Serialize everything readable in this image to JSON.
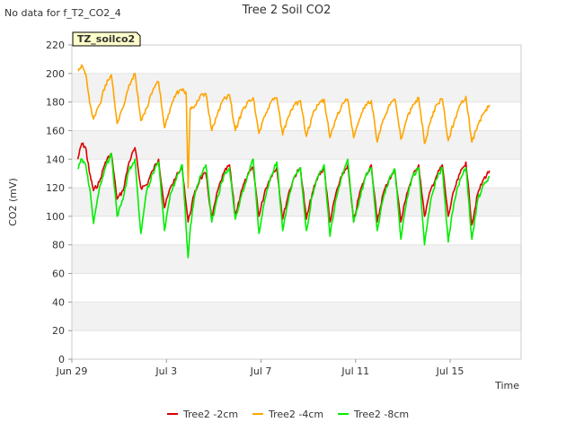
{
  "top_note": "No data for f_T2_CO2_4",
  "chart_data": {
    "type": "line",
    "title": "Tree 2 Soil CO2",
    "xlabel": "Time",
    "ylabel": "CO2 (mV)",
    "badge": "TZ_soilco2",
    "ylim": [
      0,
      220
    ],
    "yticks": [
      0,
      20,
      40,
      60,
      80,
      100,
      120,
      140,
      160,
      180,
      200,
      220
    ],
    "xlim": [
      "2023-06-29",
      "2023-07-18"
    ],
    "xticks": [
      {
        "date": "2023-06-29",
        "label": "Jun 29"
      },
      {
        "date": "2023-07-03",
        "label": "Jul 3"
      },
      {
        "date": "2023-07-07",
        "label": "Jul 7"
      },
      {
        "date": "2023-07-11",
        "label": "Jul 11"
      },
      {
        "date": "2023-07-15",
        "label": "Jul 15"
      }
    ],
    "grid": true,
    "legend_position": "bottom",
    "series": [
      {
        "name": "Tree2 -2cm",
        "color": "#dd0000",
        "points": [
          [
            "2023-06-29T06:00",
            140
          ],
          [
            "2023-06-29T10:00",
            151
          ],
          [
            "2023-06-29T14:00",
            148
          ],
          [
            "2023-06-29T18:00",
            130
          ],
          [
            "2023-06-29T22:00",
            118
          ],
          [
            "2023-06-30T04:00",
            124
          ],
          [
            "2023-06-30T10:00",
            138
          ],
          [
            "2023-06-30T16:00",
            144
          ],
          [
            "2023-06-30T22:00",
            112
          ],
          [
            "2023-07-01T04:00",
            118
          ],
          [
            "2023-07-01T10:00",
            138
          ],
          [
            "2023-07-01T16:00",
            148
          ],
          [
            "2023-07-01T22:00",
            120
          ],
          [
            "2023-07-02T04:00",
            122
          ],
          [
            "2023-07-02T10:00",
            132
          ],
          [
            "2023-07-02T16:00",
            140
          ],
          [
            "2023-07-02T22:00",
            106
          ],
          [
            "2023-07-03T04:00",
            120
          ],
          [
            "2023-07-03T10:00",
            128
          ],
          [
            "2023-07-03T16:00",
            134
          ],
          [
            "2023-07-03T22:00",
            96
          ],
          [
            "2023-07-04T04:00",
            115
          ],
          [
            "2023-07-04T10:00",
            126
          ],
          [
            "2023-07-04T16:00",
            130
          ],
          [
            "2023-07-04T22:00",
            98
          ],
          [
            "2023-07-05T04:00",
            118
          ],
          [
            "2023-07-05T10:00",
            130
          ],
          [
            "2023-07-05T16:00",
            136
          ],
          [
            "2023-07-05T22:00",
            100
          ],
          [
            "2023-07-06T04:00",
            118
          ],
          [
            "2023-07-06T10:00",
            128
          ],
          [
            "2023-07-06T16:00",
            134
          ],
          [
            "2023-07-06T22:00",
            100
          ],
          [
            "2023-07-07T04:00",
            118
          ],
          [
            "2023-07-07T10:00",
            128
          ],
          [
            "2023-07-07T16:00",
            134
          ],
          [
            "2023-07-07T22:00",
            98
          ],
          [
            "2023-07-08T04:00",
            116
          ],
          [
            "2023-07-08T10:00",
            128
          ],
          [
            "2023-07-08T16:00",
            134
          ],
          [
            "2023-07-08T22:00",
            98
          ],
          [
            "2023-07-09T04:00",
            116
          ],
          [
            "2023-07-09T10:00",
            128
          ],
          [
            "2023-07-09T16:00",
            134
          ],
          [
            "2023-07-09T22:00",
            96
          ],
          [
            "2023-07-10T04:00",
            116
          ],
          [
            "2023-07-10T10:00",
            128
          ],
          [
            "2023-07-10T16:00",
            136
          ],
          [
            "2023-07-10T22:00",
            96
          ],
          [
            "2023-07-11T04:00",
            116
          ],
          [
            "2023-07-11T10:00",
            128
          ],
          [
            "2023-07-11T16:00",
            136
          ],
          [
            "2023-07-11T22:00",
            96
          ],
          [
            "2023-07-12T04:00",
            116
          ],
          [
            "2023-07-12T10:00",
            126
          ],
          [
            "2023-07-12T16:00",
            132
          ],
          [
            "2023-07-12T22:00",
            96
          ],
          [
            "2023-07-13T04:00",
            116
          ],
          [
            "2023-07-13T10:00",
            128
          ],
          [
            "2023-07-13T16:00",
            136
          ],
          [
            "2023-07-13T22:00",
            100
          ],
          [
            "2023-07-14T04:00",
            118
          ],
          [
            "2023-07-14T10:00",
            128
          ],
          [
            "2023-07-14T16:00",
            136
          ],
          [
            "2023-07-14T22:00",
            100
          ],
          [
            "2023-07-15T04:00",
            118
          ],
          [
            "2023-07-15T10:00",
            130
          ],
          [
            "2023-07-15T16:00",
            138
          ],
          [
            "2023-07-15T22:00",
            94
          ],
          [
            "2023-07-16T04:00",
            116
          ],
          [
            "2023-07-16T10:00",
            126
          ],
          [
            "2023-07-16T16:00",
            132
          ]
        ]
      },
      {
        "name": "Tree2 -4cm",
        "color": "#ffa500",
        "points": [
          [
            "2023-06-29T06:00",
            202
          ],
          [
            "2023-06-29T10:00",
            206
          ],
          [
            "2023-06-29T14:00",
            200
          ],
          [
            "2023-06-29T18:00",
            180
          ],
          [
            "2023-06-29T22:00",
            168
          ],
          [
            "2023-06-30T04:00",
            178
          ],
          [
            "2023-06-30T10:00",
            192
          ],
          [
            "2023-06-30T16:00",
            199
          ],
          [
            "2023-06-30T22:00",
            165
          ],
          [
            "2023-07-01T04:00",
            176
          ],
          [
            "2023-07-01T10:00",
            192
          ],
          [
            "2023-07-01T16:00",
            200
          ],
          [
            "2023-07-01T22:00",
            167
          ],
          [
            "2023-07-02T04:00",
            176
          ],
          [
            "2023-07-02T10:00",
            188
          ],
          [
            "2023-07-02T16:00",
            194
          ],
          [
            "2023-07-02T22:00",
            162
          ],
          [
            "2023-07-03T04:00",
            176
          ],
          [
            "2023-07-03T10:00",
            186
          ],
          [
            "2023-07-03T16:00",
            188
          ],
          [
            "2023-07-03T20:00",
            186
          ],
          [
            "2023-07-03T22:00",
            120
          ],
          [
            "2023-07-04T00:00",
            175
          ],
          [
            "2023-07-04T04:00",
            176
          ],
          [
            "2023-07-04T10:00",
            184
          ],
          [
            "2023-07-04T16:00",
            186
          ],
          [
            "2023-07-04T22:00",
            160
          ],
          [
            "2023-07-05T04:00",
            172
          ],
          [
            "2023-07-05T10:00",
            182
          ],
          [
            "2023-07-05T16:00",
            185
          ],
          [
            "2023-07-05T22:00",
            160
          ],
          [
            "2023-07-06T04:00",
            172
          ],
          [
            "2023-07-06T10:00",
            180
          ],
          [
            "2023-07-06T16:00",
            183
          ],
          [
            "2023-07-06T22:00",
            158
          ],
          [
            "2023-07-07T04:00",
            170
          ],
          [
            "2023-07-07T10:00",
            180
          ],
          [
            "2023-07-07T16:00",
            183
          ],
          [
            "2023-07-07T22:00",
            157
          ],
          [
            "2023-07-08T04:00",
            170
          ],
          [
            "2023-07-08T10:00",
            178
          ],
          [
            "2023-07-08T16:00",
            181
          ],
          [
            "2023-07-08T22:00",
            156
          ],
          [
            "2023-07-09T04:00",
            170
          ],
          [
            "2023-07-09T10:00",
            178
          ],
          [
            "2023-07-09T16:00",
            182
          ],
          [
            "2023-07-09T22:00",
            155
          ],
          [
            "2023-07-10T04:00",
            168
          ],
          [
            "2023-07-10T10:00",
            178
          ],
          [
            "2023-07-10T16:00",
            182
          ],
          [
            "2023-07-10T22:00",
            155
          ],
          [
            "2023-07-11T04:00",
            168
          ],
          [
            "2023-07-11T10:00",
            178
          ],
          [
            "2023-07-11T16:00",
            181
          ],
          [
            "2023-07-11T22:00",
            152
          ],
          [
            "2023-07-12T04:00",
            168
          ],
          [
            "2023-07-12T10:00",
            178
          ],
          [
            "2023-07-12T16:00",
            182
          ],
          [
            "2023-07-12T22:00",
            154
          ],
          [
            "2023-07-13T04:00",
            168
          ],
          [
            "2023-07-13T10:00",
            178
          ],
          [
            "2023-07-13T16:00",
            183
          ],
          [
            "2023-07-13T22:00",
            151
          ],
          [
            "2023-07-14T04:00",
            166
          ],
          [
            "2023-07-14T10:00",
            178
          ],
          [
            "2023-07-14T16:00",
            182
          ],
          [
            "2023-07-14T22:00",
            153
          ],
          [
            "2023-07-15T04:00",
            166
          ],
          [
            "2023-07-15T10:00",
            178
          ],
          [
            "2023-07-15T16:00",
            184
          ],
          [
            "2023-07-15T22:00",
            152
          ],
          [
            "2023-07-16T04:00",
            164
          ],
          [
            "2023-07-16T10:00",
            172
          ],
          [
            "2023-07-16T16:00",
            178
          ]
        ]
      },
      {
        "name": "Tree2 -8cm",
        "color": "#00ee00",
        "points": [
          [
            "2023-06-29T06:00",
            134
          ],
          [
            "2023-06-29T10:00",
            140
          ],
          [
            "2023-06-29T14:00",
            136
          ],
          [
            "2023-06-29T18:00",
            120
          ],
          [
            "2023-06-29T22:00",
            95
          ],
          [
            "2023-06-30T04:00",
            120
          ],
          [
            "2023-06-30T10:00",
            134
          ],
          [
            "2023-06-30T16:00",
            144
          ],
          [
            "2023-06-30T22:00",
            100
          ],
          [
            "2023-07-01T04:00",
            112
          ],
          [
            "2023-07-01T10:00",
            132
          ],
          [
            "2023-07-01T16:00",
            140
          ],
          [
            "2023-07-01T22:00",
            88
          ],
          [
            "2023-07-02T04:00",
            118
          ],
          [
            "2023-07-02T10:00",
            130
          ],
          [
            "2023-07-02T16:00",
            138
          ],
          [
            "2023-07-02T22:00",
            90
          ],
          [
            "2023-07-03T04:00",
            116
          ],
          [
            "2023-07-03T10:00",
            126
          ],
          [
            "2023-07-03T16:00",
            136
          ],
          [
            "2023-07-03T22:00",
            71
          ],
          [
            "2023-07-04T00:00",
            90
          ],
          [
            "2023-07-04T04:00",
            112
          ],
          [
            "2023-07-04T10:00",
            128
          ],
          [
            "2023-07-04T16:00",
            136
          ],
          [
            "2023-07-04T22:00",
            96
          ],
          [
            "2023-07-05T04:00",
            114
          ],
          [
            "2023-07-05T10:00",
            128
          ],
          [
            "2023-07-05T16:00",
            134
          ],
          [
            "2023-07-05T22:00",
            98
          ],
          [
            "2023-07-06T04:00",
            114
          ],
          [
            "2023-07-06T10:00",
            128
          ],
          [
            "2023-07-06T16:00",
            140
          ],
          [
            "2023-07-06T22:00",
            88
          ],
          [
            "2023-07-07T04:00",
            112
          ],
          [
            "2023-07-07T10:00",
            128
          ],
          [
            "2023-07-07T16:00",
            138
          ],
          [
            "2023-07-07T22:00",
            90
          ],
          [
            "2023-07-08T04:00",
            112
          ],
          [
            "2023-07-08T10:00",
            128
          ],
          [
            "2023-07-08T16:00",
            134
          ],
          [
            "2023-07-08T22:00",
            90
          ],
          [
            "2023-07-09T04:00",
            114
          ],
          [
            "2023-07-09T10:00",
            128
          ],
          [
            "2023-07-09T16:00",
            136
          ],
          [
            "2023-07-09T22:00",
            86
          ],
          [
            "2023-07-10T04:00",
            112
          ],
          [
            "2023-07-10T10:00",
            128
          ],
          [
            "2023-07-10T16:00",
            140
          ],
          [
            "2023-07-10T22:00",
            96
          ],
          [
            "2023-07-11T04:00",
            112
          ],
          [
            "2023-07-11T10:00",
            128
          ],
          [
            "2023-07-11T16:00",
            134
          ],
          [
            "2023-07-11T22:00",
            90
          ],
          [
            "2023-07-12T04:00",
            112
          ],
          [
            "2023-07-12T10:00",
            126
          ],
          [
            "2023-07-12T16:00",
            133
          ],
          [
            "2023-07-12T22:00",
            84
          ],
          [
            "2023-07-13T04:00",
            112
          ],
          [
            "2023-07-13T10:00",
            128
          ],
          [
            "2023-07-13T16:00",
            134
          ],
          [
            "2023-07-13T22:00",
            80
          ],
          [
            "2023-07-14T04:00",
            110
          ],
          [
            "2023-07-14T10:00",
            126
          ],
          [
            "2023-07-14T16:00",
            134
          ],
          [
            "2023-07-14T22:00",
            82
          ],
          [
            "2023-07-15T04:00",
            110
          ],
          [
            "2023-07-15T10:00",
            126
          ],
          [
            "2023-07-15T16:00",
            134
          ],
          [
            "2023-07-15T22:00",
            84
          ],
          [
            "2023-07-16T04:00",
            112
          ],
          [
            "2023-07-16T10:00",
            122
          ],
          [
            "2023-07-16T16:00",
            128
          ]
        ]
      }
    ]
  }
}
